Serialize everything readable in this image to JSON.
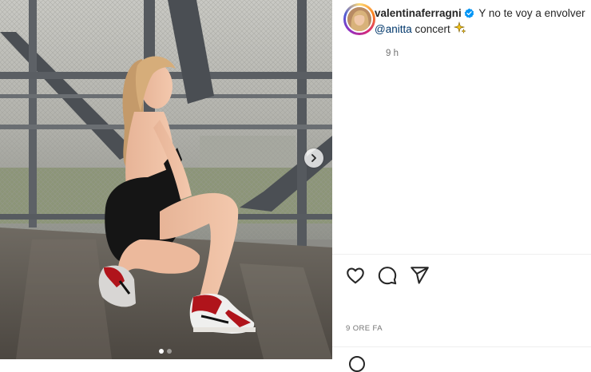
{
  "post": {
    "username": "valentinaferragni",
    "verified_icon": "verified-badge-icon",
    "caption_text": "Y no te voy a envolver",
    "mention": "@anitta",
    "caption_tail": "concert",
    "caption_emoji": "sparkles-icon",
    "time_ago": "9 h",
    "date": "9 ORE FA"
  },
  "actions": [
    "like-heart-icon",
    "comment-icon",
    "share-send-icon"
  ],
  "carousel": {
    "current_slide": 1,
    "total_slides": 2
  },
  "colors": {
    "text": "#262626",
    "muted": "#737373",
    "mention": "#00376b",
    "verified": "#0095f6"
  }
}
